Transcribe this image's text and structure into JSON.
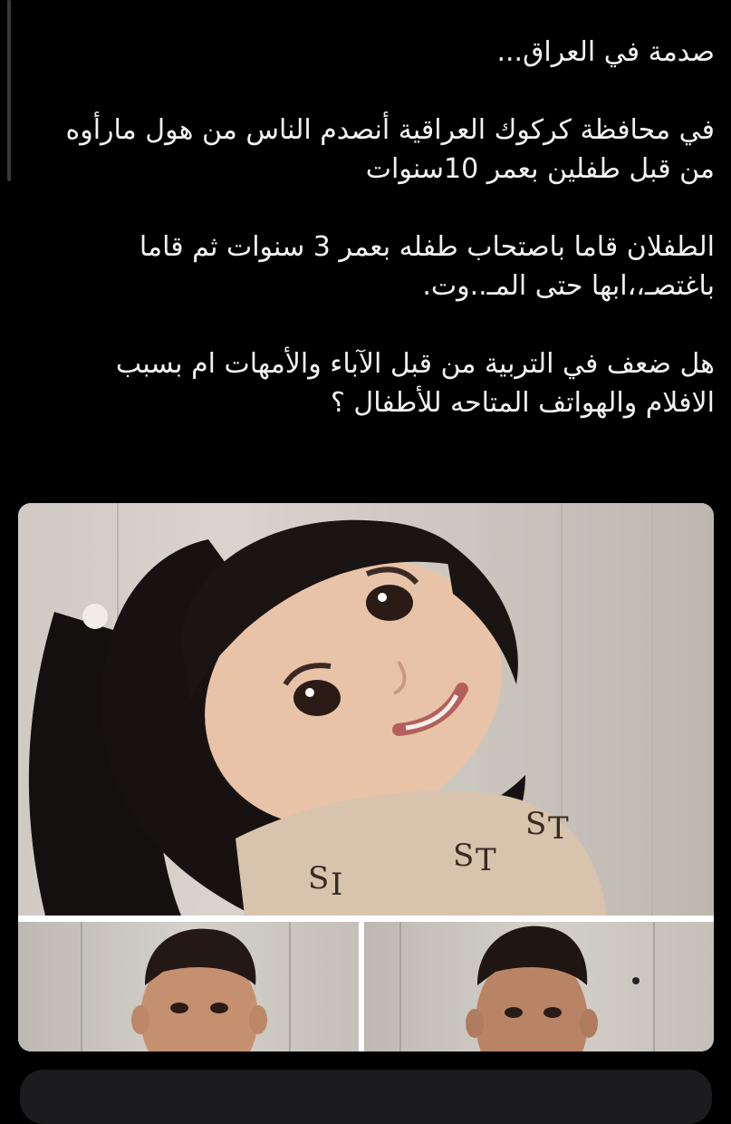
{
  "post": {
    "title": "صدمة في العراق...",
    "paragraph1_line1": "في محافظة كركوك العراقية أنصدم الناس من هول مارأوه",
    "paragraph1_line2": "من قبل طفلين بعمر 10سنوات",
    "paragraph2_line1": "الطفلان قاما باصتحاب طفله بعمر 3 سنوات ثم قاما",
    "paragraph2_line2": "باغتصـ،،ابها حتى المـ..وت.",
    "paragraph3_line1": "هل ضعف في التربية من قبل الآباء والأمهات ام بسبب",
    "paragraph3_line2": "الافلام والهواتف المتاحه للأطفال ؟"
  },
  "media": {
    "main_image": "photo-of-smiling-girl",
    "thumb_left": "photo-of-boy-1",
    "thumb_right": "photo-of-boy-2"
  },
  "colors": {
    "background": "#000000",
    "text": "#f2f2f2",
    "composer": "#1c1c1e"
  }
}
